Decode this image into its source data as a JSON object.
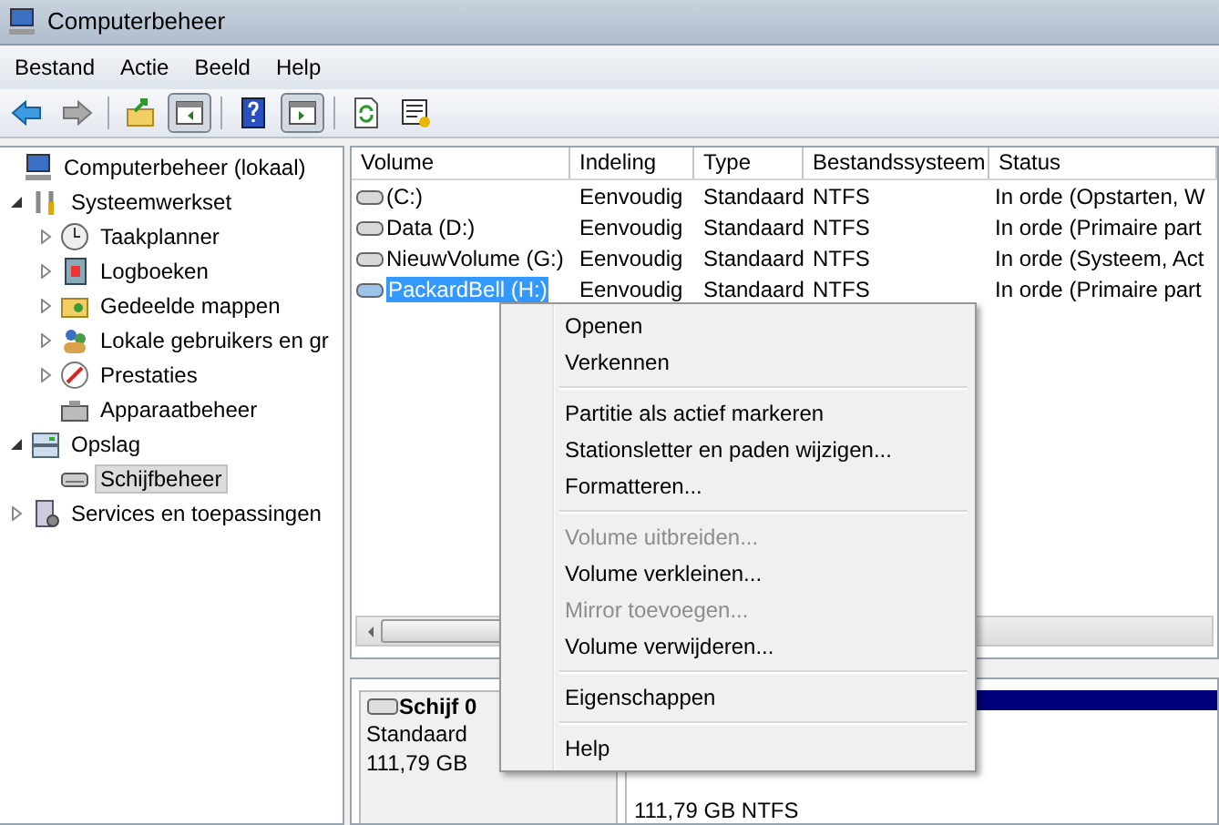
{
  "window": {
    "title": "Computerbeheer"
  },
  "menu_bar": [
    {
      "label": "Bestand"
    },
    {
      "label": "Actie"
    },
    {
      "label": "Beeld"
    },
    {
      "label": "Help"
    }
  ],
  "toolbar": [
    {
      "kind": "back",
      "pressed": false
    },
    {
      "kind": "forward",
      "pressed": false
    },
    {
      "kind": "sep"
    },
    {
      "kind": "up",
      "pressed": false
    },
    {
      "kind": "tree",
      "pressed": true
    },
    {
      "kind": "sep"
    },
    {
      "kind": "help",
      "pressed": false
    },
    {
      "kind": "pane",
      "pressed": true
    },
    {
      "kind": "sep"
    },
    {
      "kind": "refresh",
      "pressed": false
    },
    {
      "kind": "props",
      "pressed": false
    }
  ],
  "tree": [
    {
      "label": "Computerbeheer (lokaal)",
      "kind": "computer",
      "selected": false,
      "children": [
        {
          "label": "Systeemwerkset",
          "kind": "tools",
          "expanded": true,
          "selected": false,
          "children": [
            {
              "label": "Taakplanner",
              "kind": "clock",
              "expanded": false,
              "selected": false
            },
            {
              "label": "Logboeken",
              "kind": "log",
              "expanded": false,
              "selected": false
            },
            {
              "label": "Gedeelde mappen",
              "kind": "folder",
              "expanded": false,
              "selected": false
            },
            {
              "label": "Lokale gebruikers en gr",
              "kind": "users",
              "expanded": false,
              "selected": false
            },
            {
              "label": "Prestaties",
              "kind": "perf",
              "expanded": false,
              "selected": false
            },
            {
              "label": "Apparaatbeheer",
              "kind": "device",
              "selected": false
            }
          ]
        },
        {
          "label": "Opslag",
          "kind": "storage",
          "expanded": true,
          "selected": false,
          "children": [
            {
              "label": "Schijfbeheer",
              "kind": "disk",
              "selected": true
            }
          ]
        },
        {
          "label": "Services en toepassingen",
          "kind": "services",
          "expanded": false,
          "selected": false
        }
      ]
    }
  ],
  "table": {
    "columns": [
      "Volume",
      "Indeling",
      "Type",
      "Bestandssysteem",
      "Status"
    ],
    "rows": [
      {
        "cells": [
          "(C:)",
          "Eenvoudig",
          "Standaard",
          "NTFS",
          "In orde (Opstarten, W"
        ],
        "selected": false
      },
      {
        "cells": [
          "Data (D:)",
          "Eenvoudig",
          "Standaard",
          "NTFS",
          "In orde (Primaire part"
        ],
        "selected": false
      },
      {
        "cells": [
          "NieuwVolume (G:)",
          "Eenvoudig",
          "Standaard",
          "NTFS",
          "In orde (Systeem, Act"
        ],
        "selected": false
      },
      {
        "cells": [
          "PackardBell (H:)",
          "Eenvoudig",
          "Standaard",
          "NTFS",
          "In orde (Primaire part"
        ],
        "selected": true
      }
    ]
  },
  "disk": {
    "name": "Schijf 0",
    "type": "Standaard",
    "size": "111,79 GB",
    "partition": "111,79 GB NTFS"
  },
  "context_menu": {
    "sections": [
      [
        {
          "label": "Openen",
          "disabled": false
        },
        {
          "label": "Verkennen",
          "disabled": false
        }
      ],
      [
        {
          "label": "Partitie als actief markeren",
          "disabled": false
        },
        {
          "label": "Stationsletter en paden wijzigen...",
          "disabled": false
        },
        {
          "label": "Formatteren...",
          "disabled": false
        }
      ],
      [
        {
          "label": "Volume uitbreiden...",
          "disabled": true
        },
        {
          "label": "Volume verkleinen...",
          "disabled": false
        },
        {
          "label": "Mirror toevoegen...",
          "disabled": true
        },
        {
          "label": "Volume verwijderen...",
          "disabled": false
        }
      ],
      [
        {
          "label": "Eigenschappen",
          "disabled": false
        }
      ],
      [
        {
          "label": "Help",
          "disabled": false
        }
      ]
    ]
  }
}
